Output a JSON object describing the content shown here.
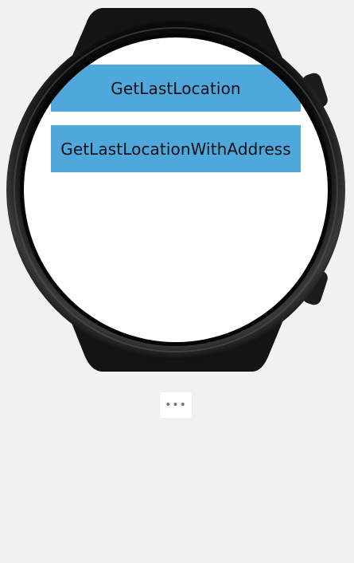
{
  "watch": {
    "buttons": [
      {
        "label": "GetLastLocation"
      },
      {
        "label": "GetLastLocationWithAddress"
      }
    ],
    "more_label": "•••",
    "button_color": "#4fa8dc",
    "screen_color": "#ffffff",
    "frame_color": "#1a1a1a"
  }
}
